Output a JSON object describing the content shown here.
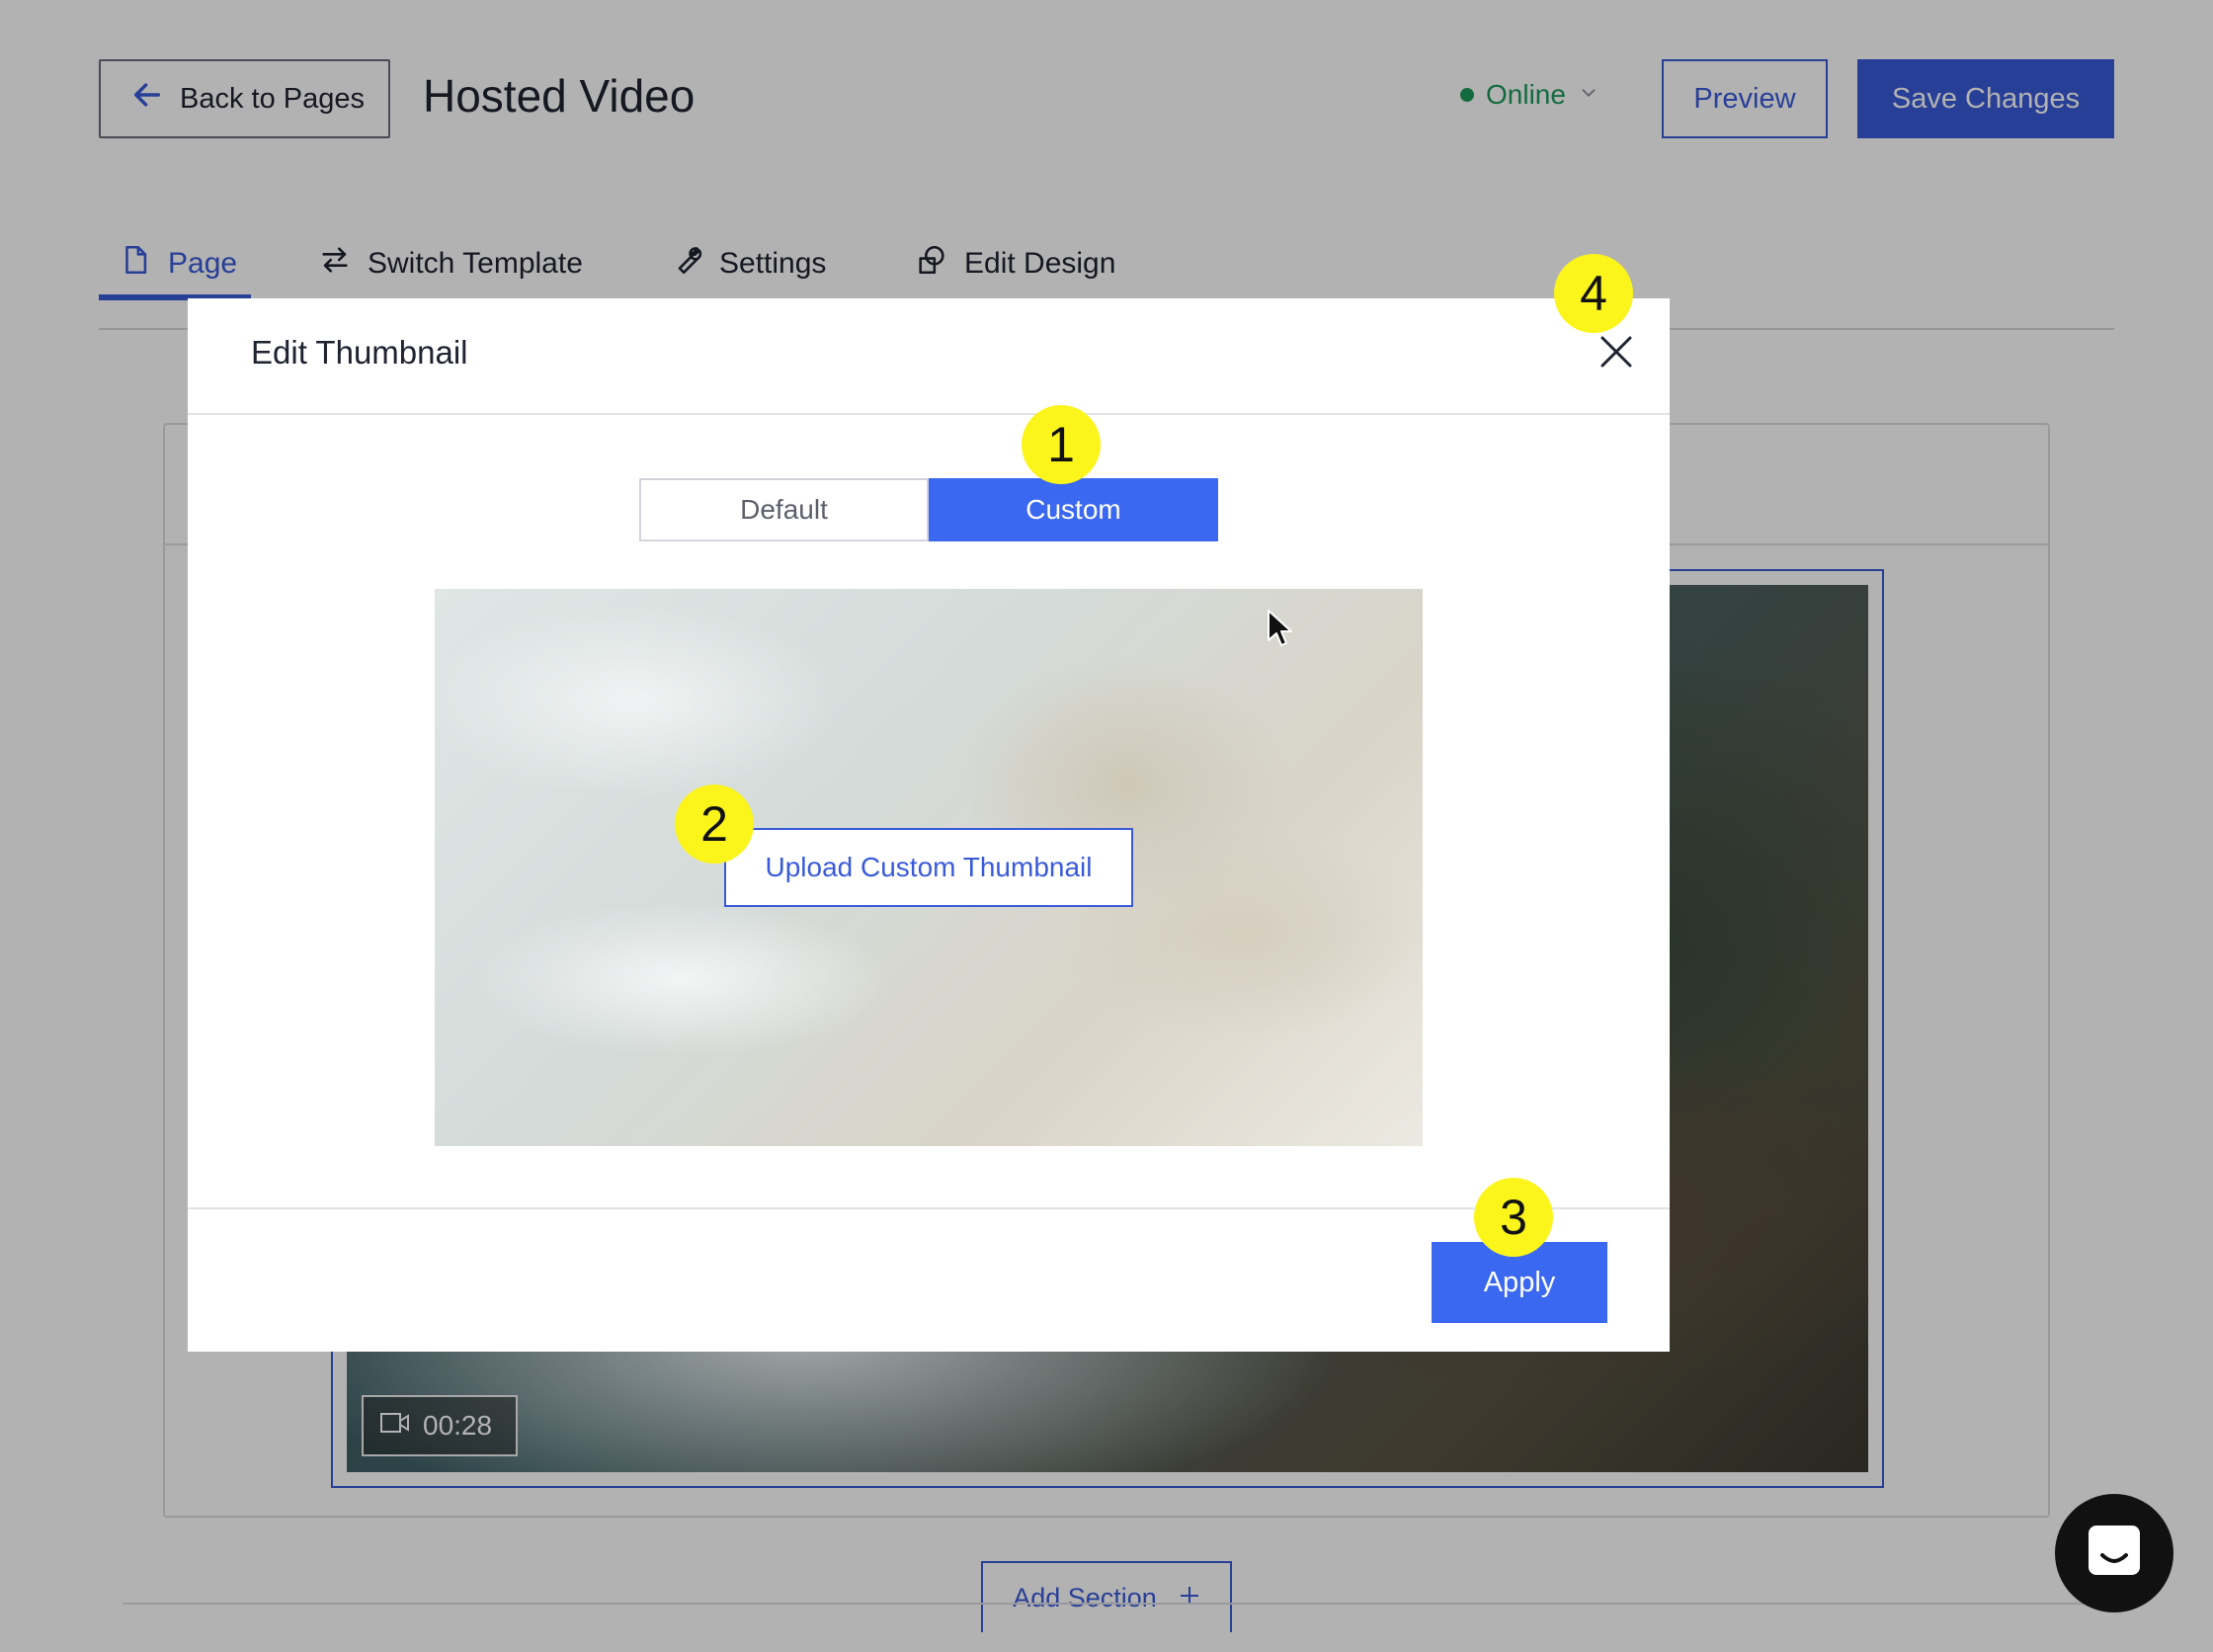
{
  "header": {
    "back_label": "Back to Pages",
    "page_title": "Hosted Video",
    "status_label": "Online",
    "preview_label": "Preview",
    "save_label": "Save Changes"
  },
  "tabs": [
    {
      "label": "Page",
      "icon": "page-icon",
      "active": true
    },
    {
      "label": "Switch Template",
      "icon": "swap-icon",
      "active": false
    },
    {
      "label": "Settings",
      "icon": "wrench-icon",
      "active": false
    },
    {
      "label": "Edit Design",
      "icon": "design-icon",
      "active": false
    }
  ],
  "video": {
    "duration": "00:28"
  },
  "add_section_label": "Add Section",
  "modal": {
    "title": "Edit Thumbnail",
    "segments": {
      "default_label": "Default",
      "custom_label": "Custom",
      "selected": "Custom"
    },
    "upload_label": "Upload Custom Thumbnail",
    "apply_label": "Apply"
  },
  "callouts": [
    "1",
    "2",
    "3",
    "4"
  ],
  "colors": {
    "accent": "#3a5bd9",
    "accent_bright": "#3a68f0",
    "online": "#1d9a5c",
    "callout": "#fbf51c"
  }
}
